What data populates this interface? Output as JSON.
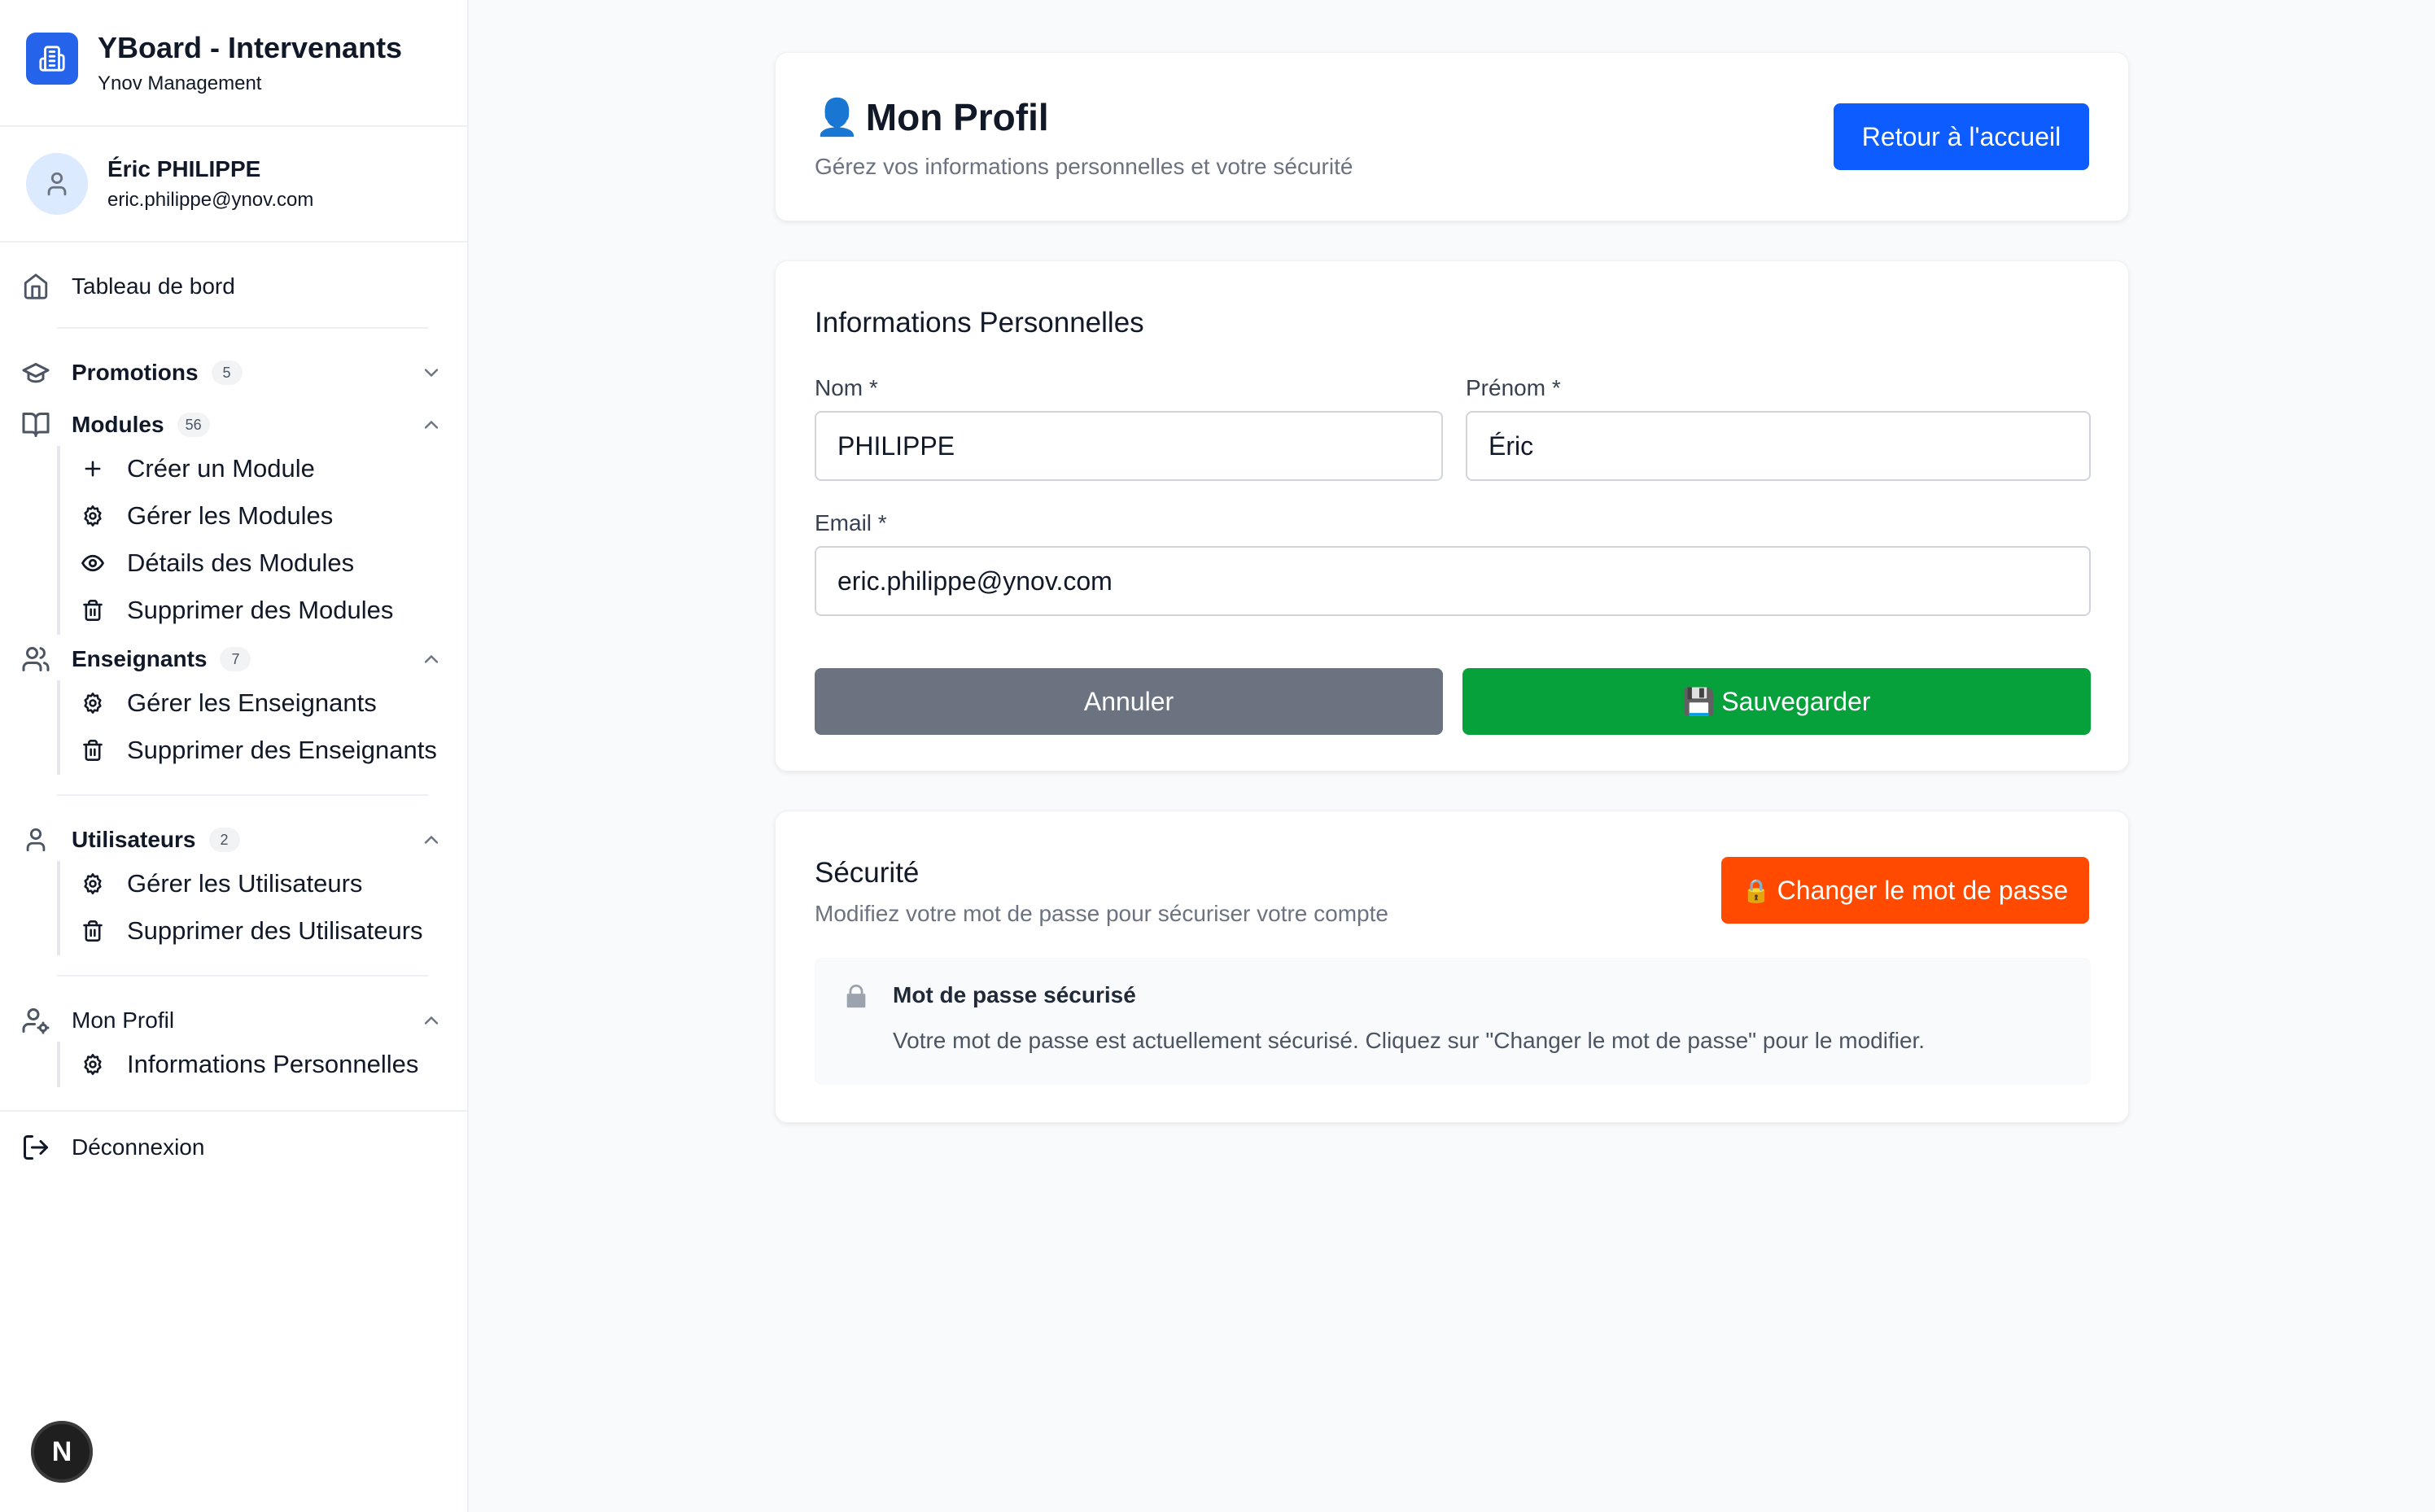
{
  "app": {
    "title": "YBoard - Intervenants",
    "subtitle": "Ynov Management"
  },
  "user": {
    "name": "Éric PHILIPPE",
    "email": "eric.philippe@ynov.com"
  },
  "nav": {
    "dashboard": "Tableau de bord",
    "promotions": {
      "label": "Promotions",
      "count": "5"
    },
    "modules": {
      "label": "Modules",
      "count": "56",
      "items": [
        "Créer un Module",
        "Gérer les Modules",
        "Détails des Modules",
        "Supprimer des Modules"
      ]
    },
    "teachers": {
      "label": "Enseignants",
      "count": "7",
      "items": [
        "Gérer les Enseignants",
        "Supprimer des Enseignants"
      ]
    },
    "users": {
      "label": "Utilisateurs",
      "count": "2",
      "items": [
        "Gérer les Utilisateurs",
        "Supprimer des Utilisateurs"
      ]
    },
    "profile": {
      "label": "Mon Profil",
      "items": [
        "Informations Personnelles"
      ]
    },
    "logout": "Déconnexion"
  },
  "header": {
    "icon": "👤",
    "title": "Mon Profil",
    "subtitle": "Gérez vos informations personnelles et votre sécurité",
    "back_button": "Retour à l'accueil"
  },
  "personal_info": {
    "title": "Informations Personnelles",
    "last_name_label": "Nom *",
    "last_name_value": "PHILIPPE",
    "first_name_label": "Prénom *",
    "first_name_value": "Éric",
    "email_label": "Email *",
    "email_value": "eric.philippe@ynov.com",
    "cancel_button": "Annuler",
    "save_icon": "💾",
    "save_button": "Sauvegarder"
  },
  "security": {
    "title": "Sécurité",
    "subtitle": "Modifiez votre mot de passe pour sécuriser votre compte",
    "change_icon": "🔒",
    "change_button": "Changer le mot de passe",
    "status_title": "Mot de passe sécurisé",
    "status_text": "Votre mot de passe est actuellement sécurisé. Cliquez sur \"Changer le mot de passe\" pour le modifier."
  },
  "dev_badge": "N",
  "colors": {
    "primary": "#0d5cff",
    "success": "#06a13b",
    "warning": "#ff4a00",
    "muted": "#6b7280"
  }
}
